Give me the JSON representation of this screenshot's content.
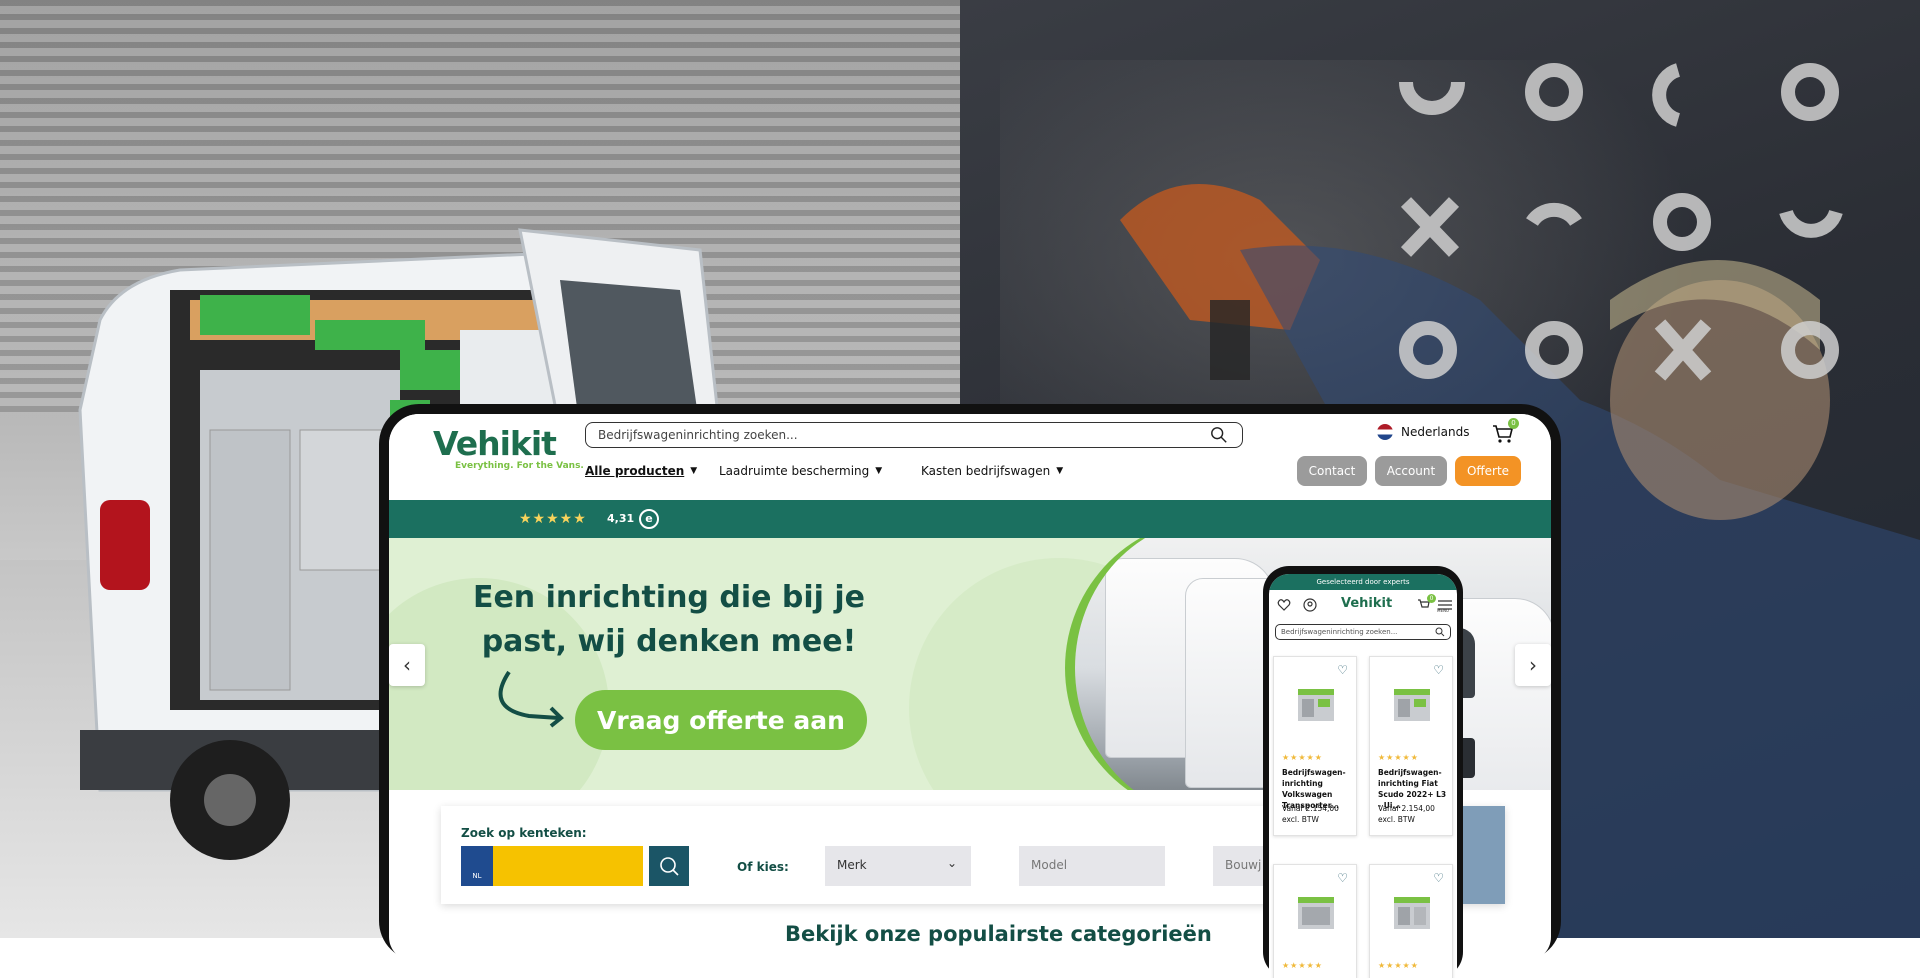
{
  "site": {
    "logo_text": "Vehikit",
    "tagline_a": "Everything.",
    "tagline_b": "For the Vans."
  },
  "header": {
    "search_placeholder": "Bedrijfswageninrichting zoeken...",
    "language": "Nederlands",
    "cart_count": "0",
    "nav": [
      {
        "label": "Alle producten"
      },
      {
        "label": "Laadruimte bescherming"
      },
      {
        "label": "Kasten bedrijfswagen"
      }
    ],
    "buttons": {
      "contact": "Contact",
      "account": "Account",
      "offerte": "Offerte"
    }
  },
  "rating": {
    "stars": "★★★★★",
    "value": "4,31",
    "seal": "e"
  },
  "hero": {
    "title": "Een inrichting die bij je past, wij denken mee!",
    "cta": "Vraag offerte aan"
  },
  "plate_search": {
    "title": "Zoek op kenteken:",
    "country": "NL",
    "or_choose": "Of kies:",
    "brand": "Merk",
    "model": "Model",
    "year": "Bouwj"
  },
  "categories_title": "Bekijk onze populairste categorieën",
  "phone": {
    "banner": "Geselecteerd door experts",
    "logo_text": "Vehikit",
    "search_placeholder": "Bedrijfswageninrichting zoeken...",
    "cart_count": "0",
    "menu_label": "MENU",
    "products": [
      {
        "name": "Bedrijfswagen­inrichting Volkswa­gen Transporter...",
        "price": "Vanaf 2.154,00",
        "tax": "excl. BTW",
        "stars": "★★★★★"
      },
      {
        "name": "Bedrijfswagen­inrichting Fiat Scu­do 2022+ L3 - Ui...",
        "price": "Vanaf 2.154,00",
        "tax": "excl. BTW",
        "stars": "★★★★★"
      },
      {
        "stars": "★★★★★"
      },
      {
        "stars": "★★★★★"
      }
    ]
  },
  "colors": {
    "brand_green": "#1b7060",
    "accent_green": "#7ac143",
    "orange": "#f39325",
    "grey_button": "#9b9b9b"
  }
}
